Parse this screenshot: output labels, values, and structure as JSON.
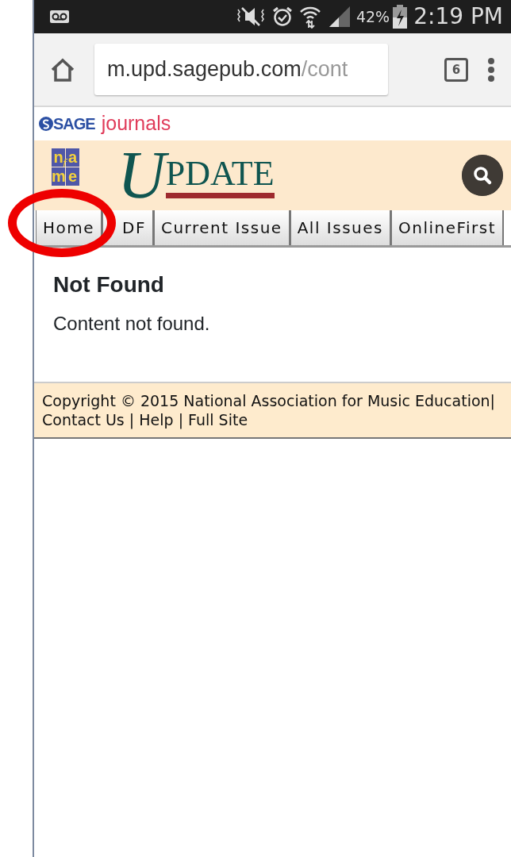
{
  "status_bar": {
    "battery": "42%",
    "time": "2:19 PM"
  },
  "browser": {
    "url_host": "m.upd.sagepub.com",
    "url_path": "/cont",
    "tab_count": "6"
  },
  "publisher": {
    "brand": "SAGE",
    "product": "journals"
  },
  "header": {
    "logo_letters": [
      "n",
      "a",
      "m",
      "e"
    ],
    "logo_middle": "f",
    "title_initial": "U",
    "title_rest": "PDATE"
  },
  "nav_tabs": [
    {
      "label": "Home",
      "selected": false
    },
    {
      "label": "DF",
      "selected": false
    },
    {
      "label": "Current Issue",
      "selected": false
    },
    {
      "label": "All Issues",
      "selected": false
    },
    {
      "label": "OnlineFirst",
      "selected": false
    }
  ],
  "content": {
    "heading": "Not Found",
    "message": "Content not found."
  },
  "footer": {
    "copyright": "Copyright © 2015 National Association for Music Education|",
    "links": [
      "Contact Us",
      "Help",
      "Full Site"
    ],
    "separator": "|"
  },
  "annotation": {
    "kind": "circle",
    "color": "#ee0000"
  }
}
